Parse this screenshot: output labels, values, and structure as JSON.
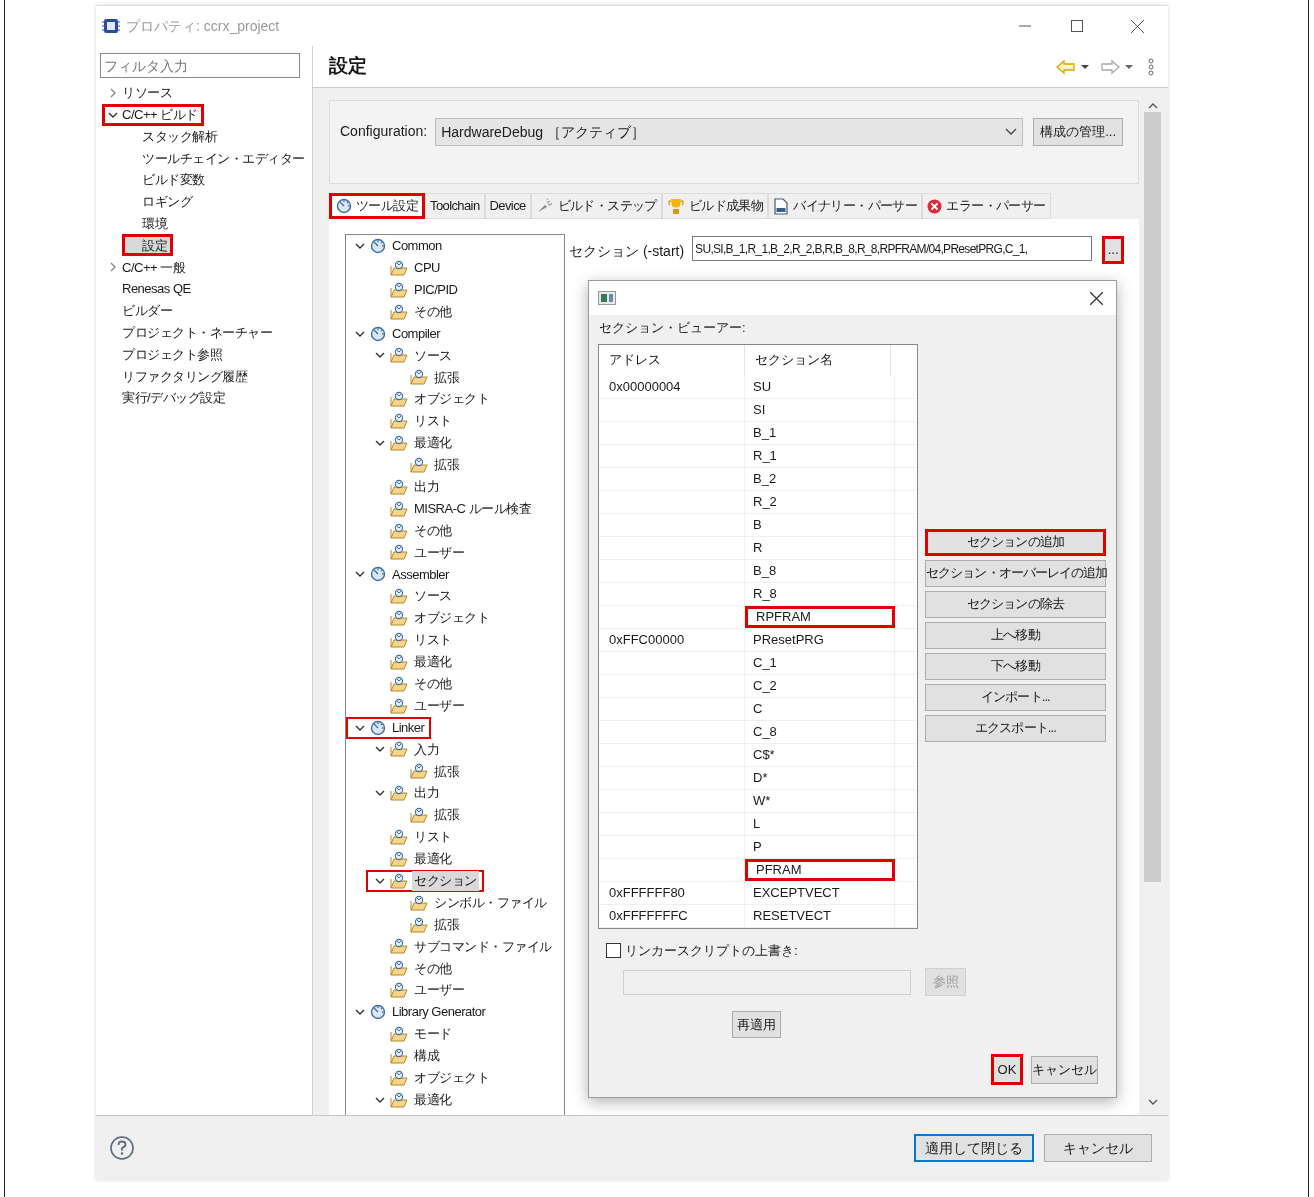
{
  "window": {
    "title": "プロパティ: ccrx_project"
  },
  "filter": {
    "placeholder": "フィルタ入力"
  },
  "nav": [
    {
      "label": "リソース",
      "expanded": false,
      "selected": false,
      "highlighted": false
    },
    {
      "label": "C/C++ ビルド",
      "expanded": true,
      "selected": false,
      "highlighted": true,
      "children": [
        {
          "label": "スタック解析",
          "selected": false,
          "highlighted": false
        },
        {
          "label": "ツールチェイン・エディター",
          "selected": false,
          "highlighted": false
        },
        {
          "label": "ビルド変数",
          "selected": false,
          "highlighted": false
        },
        {
          "label": "ロギング",
          "selected": false,
          "highlighted": false
        },
        {
          "label": "環境",
          "selected": false,
          "highlighted": false
        },
        {
          "label": "設定",
          "selected": true,
          "highlighted": true
        }
      ]
    },
    {
      "label": "C/C++ 一般",
      "expanded": false,
      "selected": false,
      "highlighted": false
    },
    {
      "label": "Renesas QE",
      "selected": false,
      "highlighted": false
    },
    {
      "label": "ビルダー",
      "selected": false,
      "highlighted": false
    },
    {
      "label": "プロジェクト・ネーチャー",
      "selected": false,
      "highlighted": false
    },
    {
      "label": "プロジェクト参照",
      "selected": false,
      "highlighted": false
    },
    {
      "label": "リファクタリング履歴",
      "selected": false,
      "highlighted": false
    },
    {
      "label": "実行/デバッグ設定",
      "selected": false,
      "highlighted": false
    }
  ],
  "page_title": "設定",
  "configuration": {
    "label": "Configuration:",
    "value": "HardwareDebug ［アクティブ］",
    "manage_button": "構成の管理..."
  },
  "tabs": [
    {
      "label": "ツール設定",
      "selected": true,
      "highlighted": true
    },
    {
      "label": "Toolchain",
      "selected": false,
      "highlighted": false
    },
    {
      "label": "Device",
      "selected": false,
      "highlighted": false
    },
    {
      "label": "ビルド・ステップ",
      "selected": false,
      "highlighted": false
    },
    {
      "label": "ビルド成果物",
      "selected": false,
      "highlighted": false
    },
    {
      "label": "バイナリー・パーサー",
      "selected": false,
      "highlighted": false
    },
    {
      "label": "エラー・パーサー",
      "selected": false,
      "highlighted": false
    }
  ],
  "tool_tree": [
    {
      "label": "Common",
      "expanded": true,
      "selected": false,
      "highlighted": false,
      "children": [
        {
          "label": "CPU",
          "selected": false,
          "highlighted": false
        },
        {
          "label": "PIC/PID",
          "selected": false,
          "highlighted": false
        },
        {
          "label": "その他",
          "selected": false,
          "highlighted": false
        }
      ]
    },
    {
      "label": "Compiler",
      "expanded": true,
      "selected": false,
      "highlighted": false,
      "children": [
        {
          "label": "ソース",
          "expanded": true,
          "selected": false,
          "highlighted": false,
          "children": [
            {
              "label": "拡張",
              "selected": false,
              "highlighted": false
            }
          ]
        },
        {
          "label": "オブジェクト",
          "selected": false,
          "highlighted": false
        },
        {
          "label": "リスト",
          "selected": false,
          "highlighted": false
        },
        {
          "label": "最適化",
          "expanded": true,
          "selected": false,
          "highlighted": false,
          "children": [
            {
              "label": "拡張",
              "selected": false,
              "highlighted": false
            }
          ]
        },
        {
          "label": "出力",
          "selected": false,
          "highlighted": false
        },
        {
          "label": "MISRA-C ルール検査",
          "selected": false,
          "highlighted": false
        },
        {
          "label": "その他",
          "selected": false,
          "highlighted": false
        },
        {
          "label": "ユーザー",
          "selected": false,
          "highlighted": false
        }
      ]
    },
    {
      "label": "Assembler",
      "expanded": true,
      "selected": false,
      "highlighted": false,
      "children": [
        {
          "label": "ソース",
          "selected": false,
          "highlighted": false
        },
        {
          "label": "オブジェクト",
          "selected": false,
          "highlighted": false
        },
        {
          "label": "リスト",
          "selected": false,
          "highlighted": false
        },
        {
          "label": "最適化",
          "selected": false,
          "highlighted": false
        },
        {
          "label": "その他",
          "selected": false,
          "highlighted": false
        },
        {
          "label": "ユーザー",
          "selected": false,
          "highlighted": false
        }
      ]
    },
    {
      "label": "Linker",
      "expanded": true,
      "selected": false,
      "highlighted": true,
      "children": [
        {
          "label": "入力",
          "expanded": true,
          "selected": false,
          "highlighted": false,
          "children": [
            {
              "label": "拡張",
              "selected": false,
              "highlighted": false
            }
          ]
        },
        {
          "label": "出力",
          "expanded": true,
          "selected": false,
          "highlighted": false,
          "children": [
            {
              "label": "拡張",
              "selected": false,
              "highlighted": false
            }
          ]
        },
        {
          "label": "リスト",
          "selected": false,
          "highlighted": false
        },
        {
          "label": "最適化",
          "selected": false,
          "highlighted": false
        },
        {
          "label": "セクション",
          "expanded": true,
          "selected": true,
          "highlighted": true,
          "children": [
            {
              "label": "シンボル・ファイル",
              "selected": false,
              "highlighted": false
            },
            {
              "label": "拡張",
              "selected": false,
              "highlighted": false
            }
          ]
        },
        {
          "label": "サブコマンド・ファイル",
          "selected": false,
          "highlighted": false
        },
        {
          "label": "その他",
          "selected": false,
          "highlighted": false
        },
        {
          "label": "ユーザー",
          "selected": false,
          "highlighted": false
        }
      ]
    },
    {
      "label": "Library Generator",
      "expanded": true,
      "selected": false,
      "highlighted": false,
      "children": [
        {
          "label": "モード",
          "selected": false,
          "highlighted": false
        },
        {
          "label": "構成",
          "selected": false,
          "highlighted": false
        },
        {
          "label": "オブジェクト",
          "selected": false,
          "highlighted": false
        },
        {
          "label": "最適化",
          "expanded": true,
          "selected": false,
          "highlighted": false
        }
      ]
    }
  ],
  "section_option": {
    "label": "セクション (-start)",
    "value": "SU,SI,B_1,R_1,B_2,R_2,B,R,B_8,R_8,RPFRAM/04,PResetPRG,C_1,",
    "browse_button": "...",
    "browse_highlighted": true
  },
  "dialog": {
    "group_label": "セクション・ビューアー:",
    "columns": [
      "アドレス",
      "セクション名"
    ],
    "rows": [
      {
        "address": "0x00000004",
        "name": "SU",
        "highlighted": false
      },
      {
        "name": "SI",
        "highlighted": false
      },
      {
        "name": "B_1",
        "highlighted": false
      },
      {
        "name": "R_1",
        "highlighted": false
      },
      {
        "name": "B_2",
        "highlighted": false
      },
      {
        "name": "R_2",
        "highlighted": false
      },
      {
        "name": "B",
        "highlighted": false
      },
      {
        "name": "R",
        "highlighted": false
      },
      {
        "name": "B_8",
        "highlighted": false
      },
      {
        "name": "R_8",
        "highlighted": false
      },
      {
        "name": "RPFRAM",
        "highlighted": true
      },
      {
        "address": "0xFFC00000",
        "name": "PResetPRG",
        "highlighted": false
      },
      {
        "name": "C_1",
        "highlighted": false
      },
      {
        "name": "C_2",
        "highlighted": false
      },
      {
        "name": "C",
        "highlighted": false
      },
      {
        "name": "C_8",
        "highlighted": false
      },
      {
        "name": "C$*",
        "highlighted": false
      },
      {
        "name": "D*",
        "highlighted": false
      },
      {
        "name": "W*",
        "highlighted": false
      },
      {
        "name": "L",
        "highlighted": false
      },
      {
        "name": "P",
        "highlighted": false
      },
      {
        "name": "PFRAM",
        "highlighted": true
      },
      {
        "address": "0xFFFFFF80",
        "name": "EXCEPTVECT",
        "highlighted": false
      },
      {
        "address": "0xFFFFFFFC",
        "name": "RESETVECT",
        "highlighted": false
      }
    ],
    "actions": [
      {
        "label": "セクションの追加",
        "highlighted": true
      },
      {
        "label": "セクション・オーバーレイの追加",
        "highlighted": false
      },
      {
        "label": "セクションの除去",
        "highlighted": false
      },
      {
        "label": "上へ移動",
        "highlighted": false
      },
      {
        "label": "下へ移動",
        "highlighted": false
      },
      {
        "label": "インポート...",
        "highlighted": false
      },
      {
        "label": "エクスポート...",
        "highlighted": false
      }
    ],
    "override": {
      "label": "リンカースクリプトの上書き:",
      "checked": false
    },
    "browse": {
      "label": "参照",
      "disabled": true
    },
    "reapply": "再適用",
    "ok": {
      "label": "OK",
      "highlighted": true
    },
    "cancel": "キャンセル"
  },
  "footer": {
    "apply_close": "適用して閉じる",
    "cancel": "キャンセル"
  }
}
